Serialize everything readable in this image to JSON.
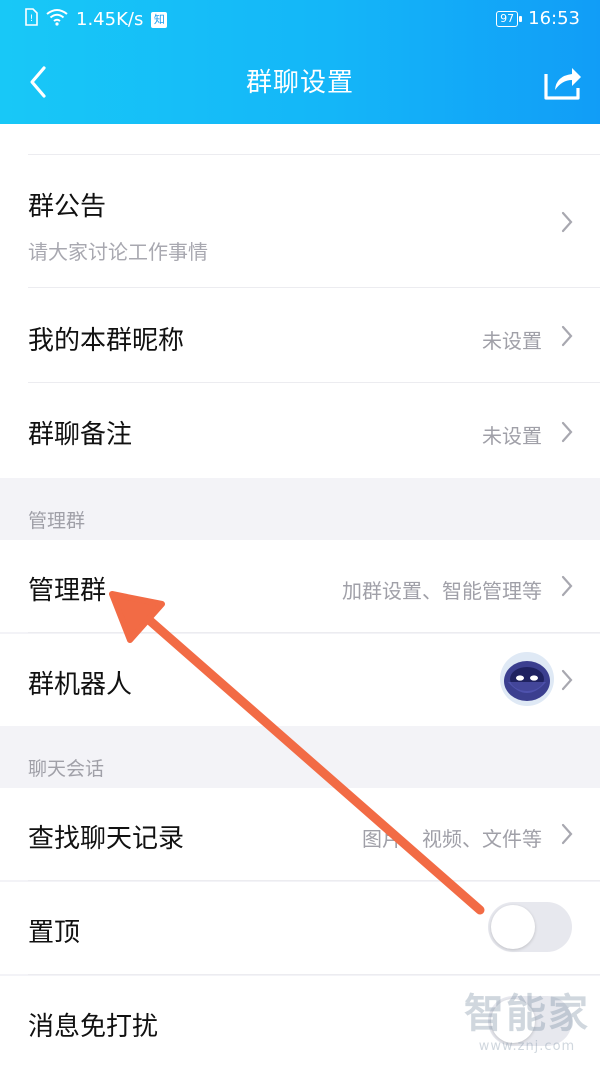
{
  "status_bar": {
    "speed": "1.45K/s",
    "app_badge": "知",
    "battery": "97",
    "time": "16:53"
  },
  "header": {
    "title": "群聊设置",
    "back_icon": "chevron-left-icon",
    "share_icon": "share-icon"
  },
  "announcement": {
    "label": "群公告",
    "subtitle": "请大家讨论工作事情"
  },
  "nickname": {
    "label": "我的本群昵称",
    "value": "未设置"
  },
  "remark": {
    "label": "群聊备注",
    "value": "未设置"
  },
  "manage_section": {
    "header": "管理群",
    "manage": {
      "label": "管理群",
      "value": "加群设置、智能管理等"
    },
    "robot": {
      "label": "群机器人"
    }
  },
  "chat_section": {
    "header": "聊天会话",
    "search": {
      "label": "查找聊天记录",
      "value": "图片、视频、文件等"
    },
    "pin": {
      "label": "置顶",
      "on": false
    },
    "dnd": {
      "label": "消息免打扰",
      "on": false
    }
  },
  "watermark": {
    "big": "智能家",
    "small": "www.znj.com"
  },
  "colors": {
    "header_start": "#18c8f7",
    "header_end": "#119df7",
    "annotation_arrow": "#f26b45"
  }
}
